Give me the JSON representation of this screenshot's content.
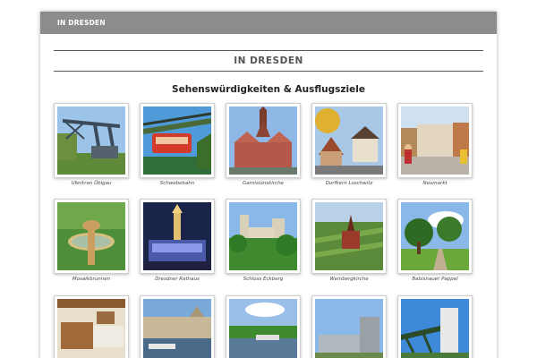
{
  "topbar": {
    "link_label": "IN DRESDEN"
  },
  "header": {
    "title": "IN DRESDEN"
  },
  "section": {
    "heading": "Sehenswürdigkeiten & Ausflugsziele"
  },
  "gallery": {
    "items": [
      {
        "label": "Uferkran Übigau",
        "icon": "crane-photo"
      },
      {
        "label": "Schwebebahn",
        "icon": "cable-car-photo"
      },
      {
        "label": "Garnisionskirche",
        "icon": "church-photo"
      },
      {
        "label": "Dorfkern Loschwitz",
        "icon": "village-photo"
      },
      {
        "label": "Neumarkt",
        "icon": "square-photo"
      },
      {
        "label": "Mosaikbrunnen",
        "icon": "fountain-photo"
      },
      {
        "label": "Dresdner Rathaus",
        "icon": "townhall-night-photo"
      },
      {
        "label": "Schloss Eckberg",
        "icon": "castle-photo"
      },
      {
        "label": "Weinbergkirche",
        "icon": "vineyard-church-photo"
      },
      {
        "label": "Babisnauer Pappel",
        "icon": "poplar-tree-photo"
      },
      {
        "label": "",
        "icon": "interior-photo"
      },
      {
        "label": "",
        "icon": "riverside-photo"
      },
      {
        "label": "",
        "icon": "river-photo"
      },
      {
        "label": "",
        "icon": "modern-building-photo"
      },
      {
        "label": "",
        "icon": "bridge-photo"
      }
    ]
  }
}
